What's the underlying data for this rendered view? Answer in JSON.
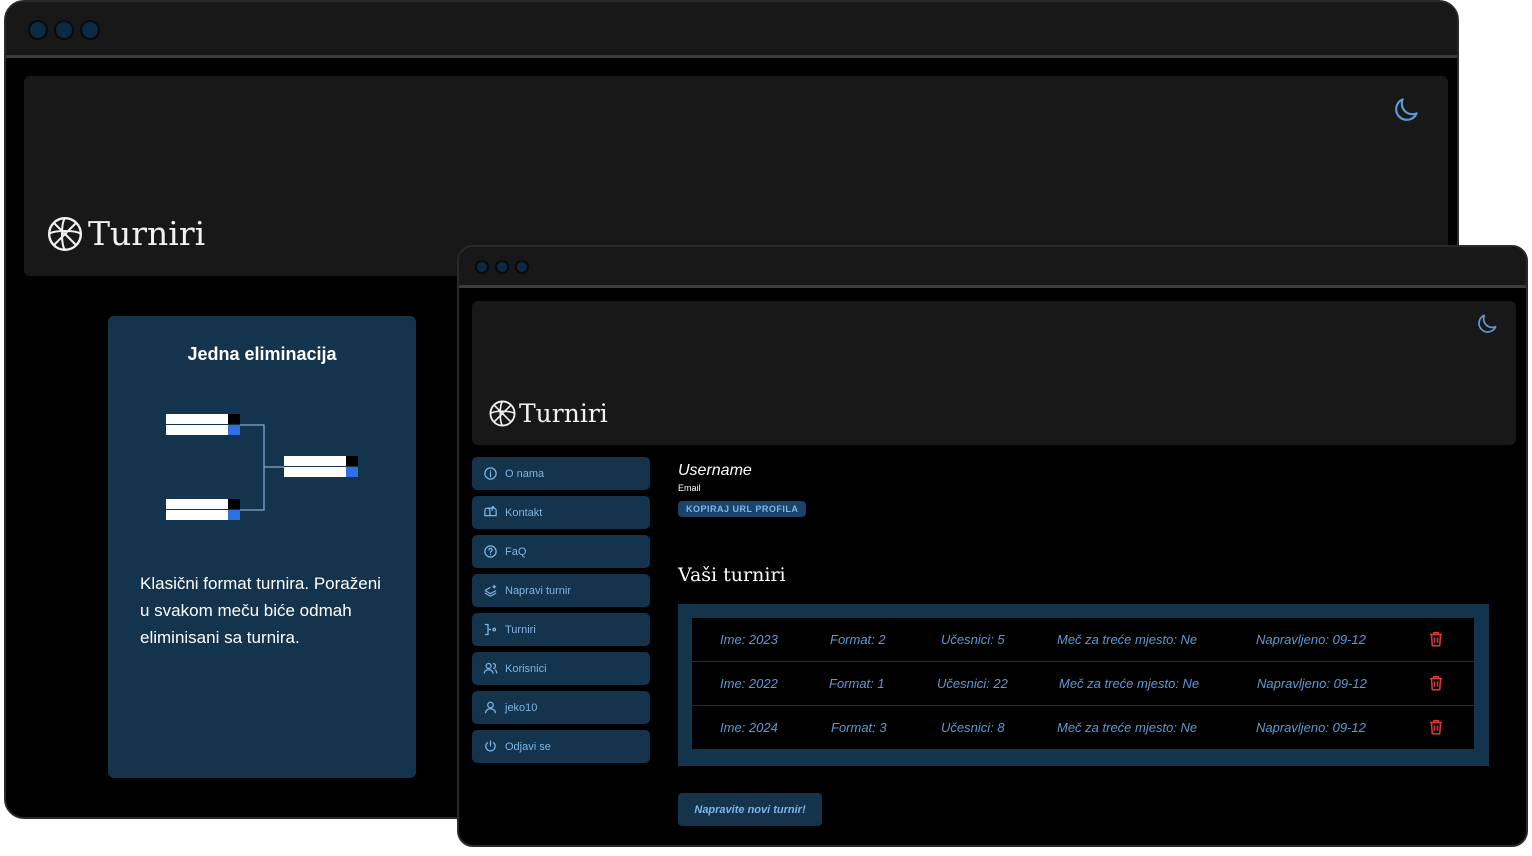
{
  "back_window": {
    "brand": "Turniri",
    "card": {
      "title": "Jedna eliminacija",
      "description": "Klasični format turnira. Poraženi u svakom meču biće odmah eliminisani sa turnira."
    }
  },
  "front_window": {
    "brand": "Turniri",
    "sidebar": [
      {
        "label": "O nama",
        "icon": "info-icon"
      },
      {
        "label": "Kontakt",
        "icon": "mailbox-icon"
      },
      {
        "label": "FaQ",
        "icon": "question-icon"
      },
      {
        "label": "Napravi turnir",
        "icon": "layers-plus-icon"
      },
      {
        "label": "Turniri",
        "icon": "bracket-icon"
      },
      {
        "label": "Korisnici",
        "icon": "users-icon"
      },
      {
        "label": "jeko10",
        "icon": "user-icon"
      },
      {
        "label": "Odjavi se",
        "icon": "power-icon"
      }
    ],
    "profile": {
      "username": "Username",
      "email": "Email",
      "copy_button": "KOPIRAJ URL PROFILA"
    },
    "section_title": "Vaši turniri",
    "tournaments": [
      {
        "name": "Ime: 2023",
        "format": "Format: 2",
        "participants": "Učesnici: 5",
        "third_place": "Meč za treće mjesto: Ne",
        "created": "Napravljeno: 09-12"
      },
      {
        "name": "Ime: 2022",
        "format": "Format: 1",
        "participants": "Učesnici: 22",
        "third_place": "Meč za treće mjesto: Ne",
        "created": "Napravljeno: 09-12"
      },
      {
        "name": "Ime: 2024",
        "format": "Format: 3",
        "participants": "Učesnici: 8",
        "third_place": "Meč za treće mjesto: Ne",
        "created": "Napravljeno: 09-12"
      }
    ],
    "new_button": "Napravite novi turnir!"
  },
  "colors": {
    "accent": "#5b9bd5",
    "card_bg": "#14334d",
    "header_bg": "#181818",
    "delete": "#e53935"
  }
}
